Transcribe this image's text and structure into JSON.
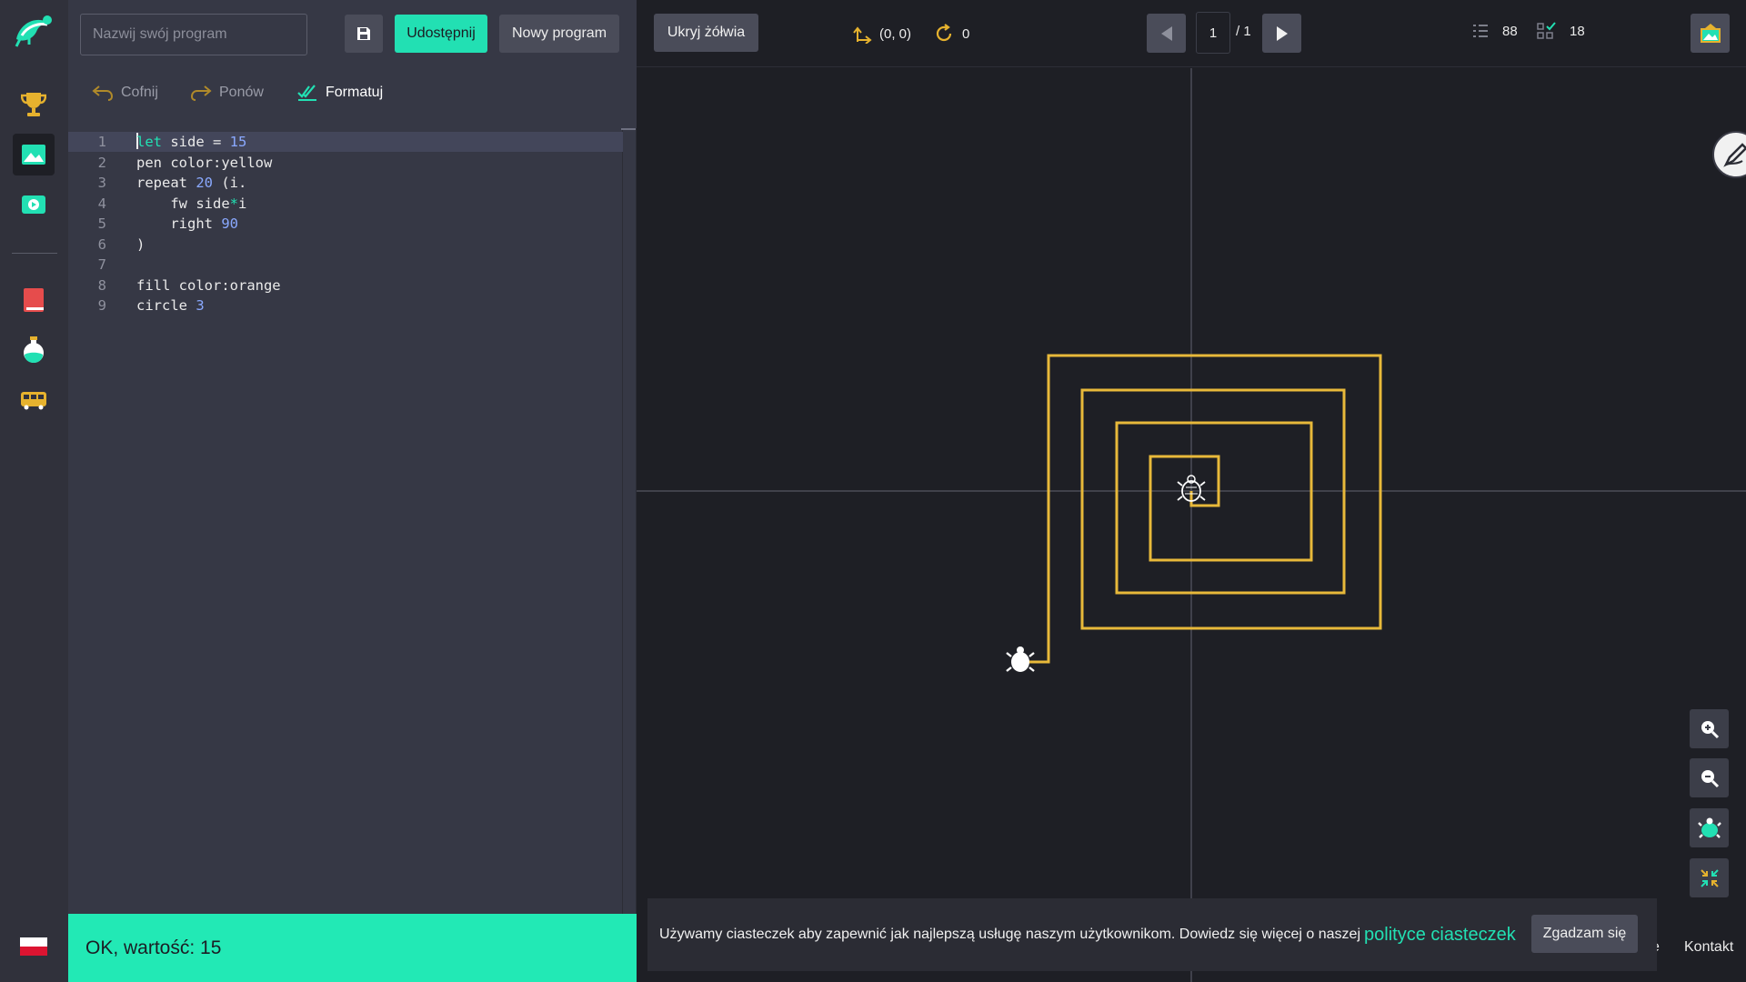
{
  "rail": {
    "items": [
      {
        "name": "trophy-icon",
        "label": ""
      },
      {
        "name": "drawing-icon",
        "label": ""
      },
      {
        "name": "video-icon",
        "label": ""
      },
      {
        "name": "book-icon",
        "label": ""
      },
      {
        "name": "flask-icon",
        "label": ""
      },
      {
        "name": "bus-icon",
        "label": ""
      }
    ],
    "language_flag": "PL"
  },
  "editor": {
    "name_placeholder": "Nazwij swój program",
    "name_value": "",
    "share_label": "Udostępnij",
    "new_program_label": "Nowy program",
    "undo_label": "Cofnij",
    "redo_label": "Ponów",
    "format_label": "Formatuj",
    "code_lines": [
      {
        "n": "1",
        "text": "let side = 15"
      },
      {
        "n": "2",
        "text": "pen color:yellow"
      },
      {
        "n": "3",
        "text": "repeat 20 (i."
      },
      {
        "n": "4",
        "text": "    fw side*i"
      },
      {
        "n": "5",
        "text": "    right 90"
      },
      {
        "n": "6",
        "text": ")"
      },
      {
        "n": "7",
        "text": ""
      },
      {
        "n": "8",
        "text": "fill color:orange"
      },
      {
        "n": "9",
        "text": "circle 3"
      }
    ],
    "status_text": "OK, wartość: 15"
  },
  "stage": {
    "hide_turtle_label": "Ukryj żółwia",
    "position": "(0, 0)",
    "angle": "0",
    "page_current": "1",
    "page_total": "/ 1",
    "stat_lines": "88",
    "stat_done": "18",
    "pen_color": "#e8b93a",
    "accent": "#22e0b3"
  },
  "cookie": {
    "text": "Używamy ciasteczek aby zapewnić jak najlepszą usługę naszym użytkownikom. Dowiedz się więcej o naszej",
    "link": "polityce ciasteczek",
    "agree": "Zgadzam się"
  },
  "footer": {
    "partial": "e",
    "contact": "Kontakt"
  }
}
